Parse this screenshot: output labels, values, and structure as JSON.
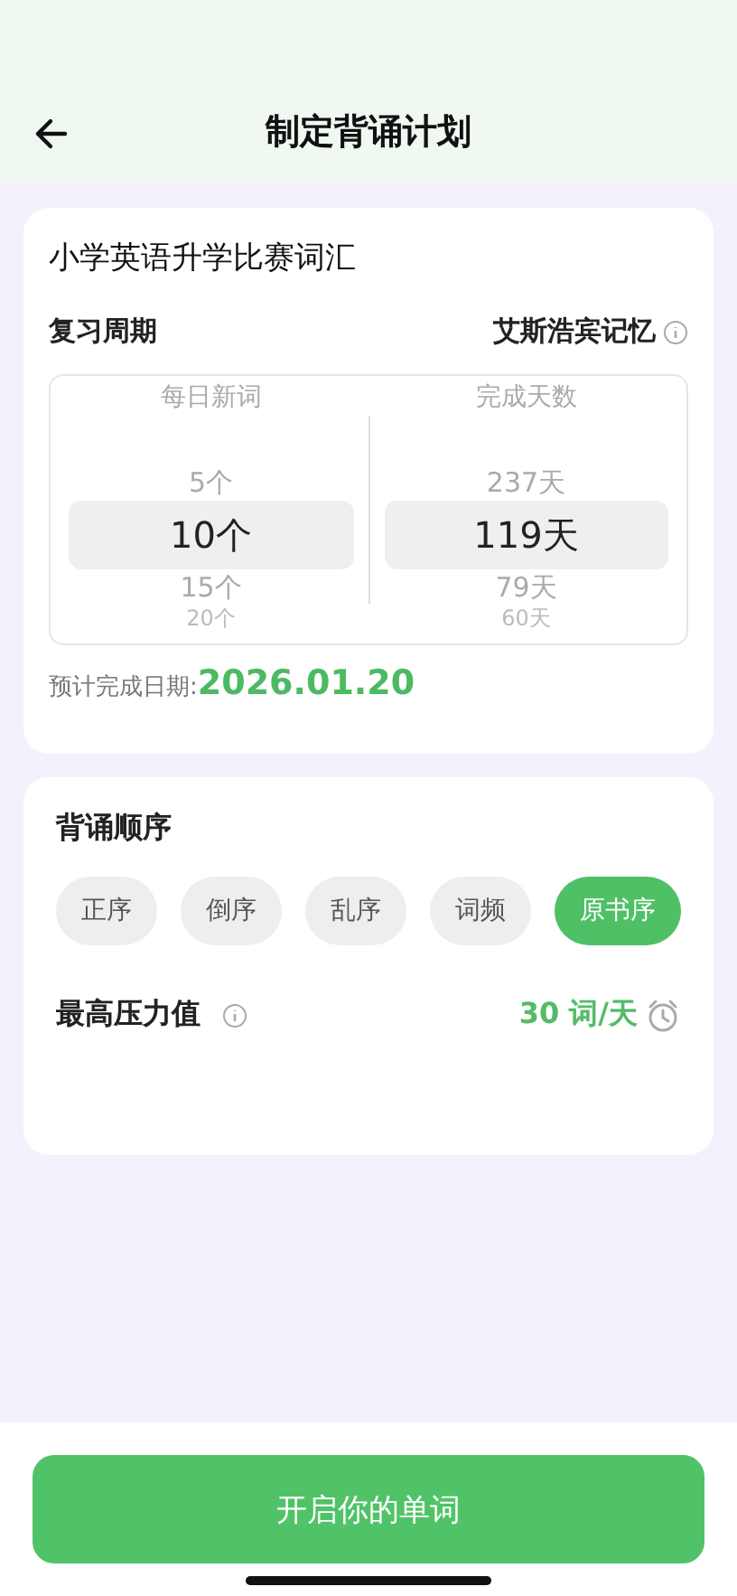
{
  "header": {
    "title": "制定背诵计划"
  },
  "plan": {
    "book": "小学英语升学比赛词汇",
    "cycle_label": "复习周期",
    "method": "艾斯浩宾记忆",
    "pickers": [
      {
        "heading": "每日新词",
        "options": [
          {
            "label": "5个",
            "selected": false
          },
          {
            "label": "10个",
            "selected": true
          },
          {
            "label": "15个",
            "selected": false
          },
          {
            "label": "20个",
            "selected": false
          }
        ]
      },
      {
        "heading": "完成天数",
        "options": [
          {
            "label": "237天",
            "selected": false
          },
          {
            "label": "119天",
            "selected": true
          },
          {
            "label": "79天",
            "selected": false
          },
          {
            "label": "60天",
            "selected": false
          }
        ]
      }
    ],
    "finish_label": "预计完成日期:",
    "finish_date": "2026.01.20"
  },
  "order": {
    "title": "背诵顺序",
    "options": [
      {
        "label": "正序",
        "selected": false
      },
      {
        "label": "倒序",
        "selected": false
      },
      {
        "label": "乱序",
        "selected": false
      },
      {
        "label": "词频",
        "selected": false
      },
      {
        "label": "原书序",
        "selected": true
      }
    ],
    "pressure_label": "最高压力值",
    "pressure_value": "30 词/天"
  },
  "start_button": "开启你的单词"
}
